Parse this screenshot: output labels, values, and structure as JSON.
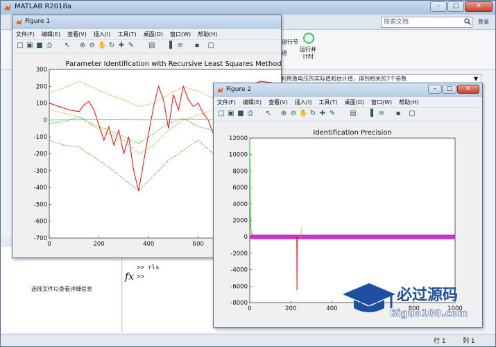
{
  "main": {
    "title": "MATLAB R2018a",
    "search_placeholder": "搜索文档",
    "help_short": "登录",
    "ribbon": {
      "run_section_line1": "运行节",
      "run_section_line2": "进",
      "run_timed_line1": "运行并",
      "run_timed_line2": "计时"
    },
    "address_text": "辨识，利用激电压的实际值和估计值，得到相关的7个参数",
    "details_message": "选择文件以查看详细信息",
    "command_history": [
      ">> rls",
      ">>"
    ],
    "fx_symbol": "fx",
    "status": {
      "row_label": "行",
      "row_value": "1",
      "col_label": "列",
      "col_value": "1"
    }
  },
  "figure_menu": [
    "文件(F)",
    "编辑(E)",
    "查看(V)",
    "插入(I)",
    "工具(T)",
    "桌面(D)",
    "窗口(W)",
    "帮助(H)"
  ],
  "figure1": {
    "title": "Figure 1",
    "colors": {
      "red": "#ff0000",
      "orange": "#ff8000",
      "green": "#00c000",
      "lightgreen": "#60e060",
      "olive": "#5a8a00"
    },
    "chart_data": {
      "type": "line",
      "title": "Parameter Identification with Recursive Least Squares Method",
      "xlim": [
        0,
        1000
      ],
      "ylim": [
        -700,
        300
      ],
      "xticks": [
        0,
        200,
        400,
        600,
        800,
        1000
      ],
      "yticks": [
        300,
        200,
        100,
        0,
        -100,
        -200,
        -300,
        -400,
        -500,
        -600,
        -700
      ],
      "series": [
        {
          "color": "#ff0000",
          "style": "solid",
          "x": [
            0,
            40,
            80,
            120,
            140,
            160,
            180,
            200,
            220,
            240,
            260,
            280,
            300,
            320,
            340,
            360,
            380,
            400,
            420,
            440,
            460,
            480,
            500,
            520,
            540,
            560,
            580,
            600,
            620,
            640,
            660,
            680,
            700,
            720,
            740,
            760,
            800,
            850,
            900,
            950,
            1000
          ],
          "y": [
            100,
            80,
            60,
            50,
            90,
            110,
            60,
            -30,
            -120,
            -40,
            -150,
            -60,
            -200,
            -100,
            -300,
            -420,
            -250,
            -80,
            80,
            200,
            120,
            -50,
            150,
            60,
            200,
            120,
            80,
            100,
            40,
            0,
            -80,
            -120,
            -40,
            60,
            120,
            100,
            200,
            230,
            220,
            210,
            150
          ]
        },
        {
          "color": "#ff8000",
          "style": "dotted",
          "x": [
            0,
            60,
            120,
            180,
            240,
            300,
            360,
            420,
            480,
            540,
            600,
            660,
            720,
            780,
            840,
            900,
            1000
          ],
          "y": [
            160,
            190,
            230,
            190,
            150,
            120,
            80,
            100,
            150,
            200,
            170,
            130,
            120,
            140,
            160,
            170,
            175
          ]
        },
        {
          "color": "#ff8000",
          "style": "dotted",
          "x": [
            0,
            60,
            120,
            180,
            240,
            300,
            360,
            420,
            480,
            540,
            600,
            660,
            720,
            780,
            840,
            900,
            1000
          ],
          "y": [
            60,
            40,
            20,
            -40,
            -80,
            -120,
            -200,
            -150,
            -60,
            0,
            30,
            60,
            80,
            70,
            80,
            75,
            80
          ]
        },
        {
          "color": "#60e060",
          "style": "solid",
          "x": [
            0,
            200,
            400,
            600,
            800,
            1000
          ],
          "y": [
            0,
            2,
            1,
            3,
            2,
            2
          ]
        },
        {
          "color": "#5a8a00",
          "style": "dotted",
          "x": [
            0,
            60,
            120,
            180,
            240,
            300,
            360,
            420,
            480,
            540,
            600,
            660,
            720,
            780,
            840,
            900,
            1000
          ],
          "y": [
            -120,
            -150,
            -160,
            -220,
            -280,
            -350,
            -420,
            -330,
            -240,
            -180,
            -120,
            -200,
            -160,
            -110,
            -110,
            -110,
            -110
          ]
        },
        {
          "color": "#00c000",
          "style": "dotted",
          "x": [
            0,
            60,
            120,
            180,
            240,
            300,
            360,
            420,
            480,
            540,
            600,
            660,
            720,
            780,
            840,
            900,
            1000
          ],
          "y": [
            -20,
            -10,
            20,
            -30,
            -60,
            -100,
            -140,
            -80,
            -20,
            10,
            -40,
            -60,
            -30,
            -30,
            -25,
            -25,
            -25
          ]
        }
      ]
    }
  },
  "figure2": {
    "title": "Figure 2",
    "chart_data": {
      "type": "line",
      "title": "Identification Precision",
      "xlim": [
        0,
        1000
      ],
      "ylim": [
        -8000,
        12000
      ],
      "xticks": [
        0,
        200,
        400,
        600,
        800,
        1000
      ],
      "yticks": [
        12000,
        10000,
        8000,
        6000,
        4000,
        2000,
        0,
        -2000,
        -4000,
        -6000,
        -8000
      ],
      "series": [
        {
          "color": "#ff00ff",
          "style": "band",
          "x": [
            0,
            1000
          ],
          "y": [
            0,
            0
          ]
        },
        {
          "color": "#00e000",
          "style": "solid",
          "x": [
            0,
            2,
            4,
            8,
            20,
            1000
          ],
          "y": [
            12000,
            4000,
            1500,
            400,
            0,
            0
          ]
        },
        {
          "color": "#ff0000",
          "style": "solid",
          "x": [
            229,
            230,
            231
          ],
          "y": [
            0,
            -6500,
            0
          ]
        },
        {
          "color": "#ff8000",
          "style": "dotted",
          "x": [
            250,
            251,
            252
          ],
          "y": [
            0,
            1200,
            0
          ]
        }
      ]
    }
  },
  "watermark": {
    "line1": "必过源码",
    "line2": "Biguo100.com",
    "color": "#1e4fa0"
  }
}
